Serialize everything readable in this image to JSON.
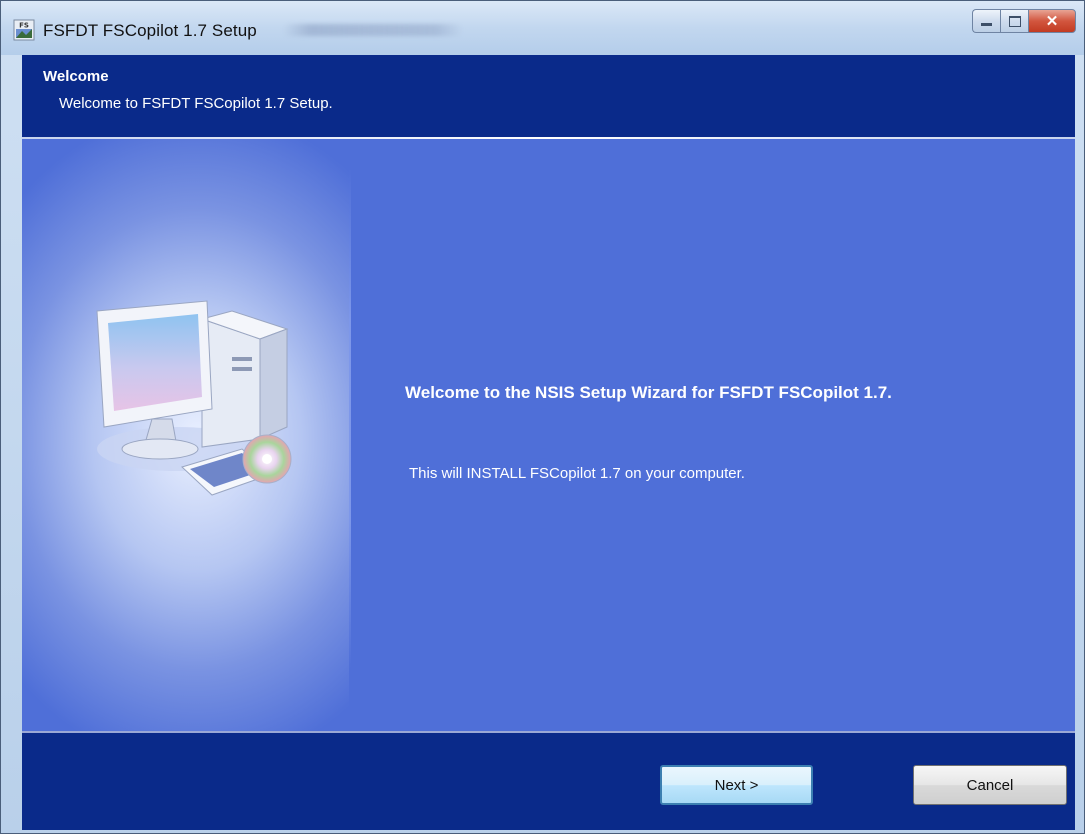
{
  "window": {
    "title": "FSFDT FSCopilot 1.7 Setup",
    "caption_buttons": [
      "minimize",
      "maximize",
      "close"
    ]
  },
  "header": {
    "title": "Welcome",
    "subtitle": "Welcome to FSFDT FSCopilot 1.7 Setup."
  },
  "main": {
    "heading": "Welcome to the NSIS Setup Wizard for FSFDT FSCopilot 1.7.",
    "body": "This will INSTALL FSCopilot 1.7 on your computer.",
    "illustration": "computer-icon"
  },
  "footer": {
    "next_label": "Next >",
    "cancel_label": "Cancel"
  },
  "colors": {
    "header_bg": "#0a2a8a",
    "content_bg": "#4f6fd8",
    "footer_bg": "#0a2a8a"
  }
}
